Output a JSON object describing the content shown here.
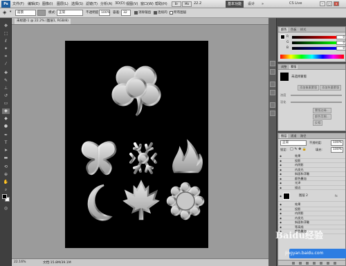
{
  "menubar": {
    "logo": "Ps",
    "items": [
      "文件(F)",
      "编辑(E)",
      "图像(I)",
      "图层(L)",
      "选择(S)",
      "滤镜(T)",
      "分析(A)",
      "3D(D)",
      "视图(V)",
      "窗口(W)",
      "帮助(H)"
    ],
    "zoom": "22.2",
    "workspace_active": "基本功能",
    "workspace_other": "设计",
    "workspace_more": "»",
    "cslive": "CS Live",
    "win_minimize": "─",
    "win_restore": "□",
    "win_close": "✕"
  },
  "options": {
    "mode_label": "模式:",
    "mode_value": "正常",
    "opacity_label": "不透明度:",
    "opacity_value": "100%",
    "tolerance_label": "容差:",
    "tolerance_value": "32",
    "antialias_label": "消除锯齿",
    "contiguous_label": "连续的",
    "all_layers_label": "所有图层",
    "brush_label": "前景"
  },
  "document": {
    "tab_title": "未标题-1 @ 22.2% (图层1, RGB/8)",
    "status_zoom": "22.16%",
    "status_doc": "文档:15.8M/39.1M"
  },
  "adjustments": {
    "tabs": [
      "颜色",
      "色板",
      "样式"
    ],
    "sliders": [
      {
        "label": "R",
        "value": "0"
      },
      {
        "label": "G",
        "value": "0"
      },
      {
        "label": "B",
        "value": "0"
      }
    ],
    "tabs2": [
      "调整",
      "蒙版"
    ],
    "mask_title": "未选择蒙版",
    "btn_add_pixel": "添加像素蒙版",
    "btn_add_vector": "添加矢量蒙版",
    "btn_density": "浓度",
    "btn_feather": "羽化",
    "btn_refine": "蒙版边缘...",
    "btn_color_range": "颜色范围...",
    "btn_invert": "反相"
  },
  "layers": {
    "tabs": [
      "图层",
      "通道",
      "路径"
    ],
    "blend": "正常",
    "opacity_label": "不透明度:",
    "opacity_value": "100%",
    "lock_label": "锁定:",
    "fill_label": "填充:",
    "fill_value": "100%",
    "group1_effects": [
      "效果",
      "投影",
      "内阴影",
      "内发光",
      "斜面和浮雕",
      "颜色叠加",
      "光泽",
      "描边"
    ],
    "layer2_name": "图层 2",
    "fx_symbol": "fx",
    "group2_effects": [
      "效果",
      "投影",
      "内阴影",
      "内发光",
      "斜面和浮雕",
      "等高线",
      "颜色叠加"
    ]
  },
  "watermark": {
    "main": "Baidu经验",
    "sub": "jingyan.baidu.com"
  },
  "icons": [
    "lasso-icon",
    "magic-wand-icon",
    "crop-icon",
    "eyedropper-icon",
    "healing-brush-icon",
    "brush-icon",
    "stamp-icon",
    "history-brush-icon",
    "eraser-icon",
    "paint-bucket-icon",
    "blur-icon",
    "dodge-icon",
    "pen-icon",
    "type-icon",
    "path-selection-icon",
    "shape-icon",
    "3d-rotate-icon",
    "3d-orbit-icon",
    "hand-icon",
    "zoom-icon",
    "clover-shape",
    "butterfly-shape",
    "snowflake-shape",
    "flame-shape",
    "moon-shape",
    "maple-leaf-shape",
    "flower-shape"
  ],
  "colors": {
    "canvas": "#000000",
    "workspace": "#9b9b9b",
    "panel": "#474747",
    "accent": "#2d7de2"
  }
}
